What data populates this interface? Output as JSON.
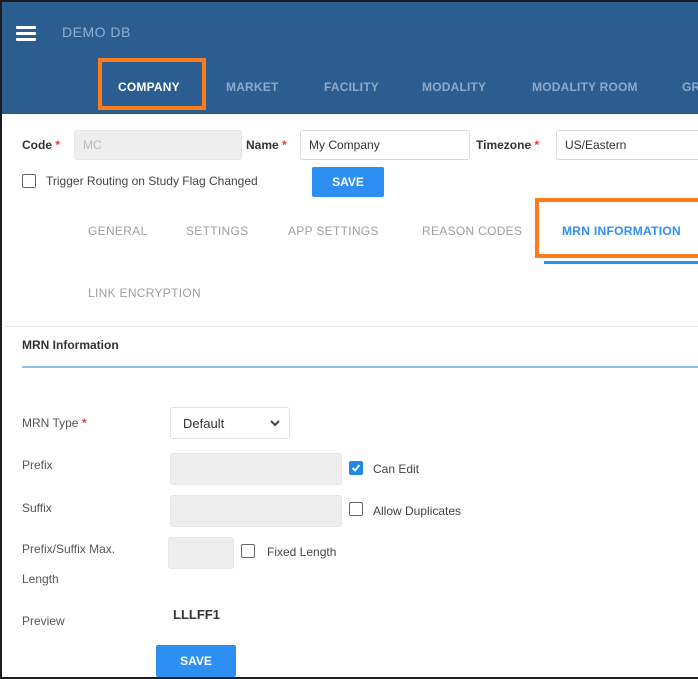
{
  "header": {
    "app_title": "DEMO DB",
    "nav_tabs": [
      {
        "label": "COMPANY",
        "active": true
      },
      {
        "label": "MARKET",
        "active": false
      },
      {
        "label": "FACILITY",
        "active": false
      },
      {
        "label": "MODALITY",
        "active": false
      },
      {
        "label": "MODALITY ROOM",
        "active": false
      },
      {
        "label": "GR",
        "active": false
      }
    ]
  },
  "company_form": {
    "code_label": "Code",
    "code_value": "MC",
    "name_label": "Name",
    "name_value": "My Company",
    "timezone_label": "Timezone",
    "timezone_value": "US/Eastern",
    "trigger_routing_label": "Trigger Routing on Study Flag Changed",
    "trigger_routing_checked": false,
    "save_label": "SAVE"
  },
  "sub_tabs": [
    {
      "label": "GENERAL",
      "active": false
    },
    {
      "label": "SETTINGS",
      "active": false
    },
    {
      "label": "APP SETTINGS",
      "active": false
    },
    {
      "label": "REASON CODES",
      "active": false
    },
    {
      "label": "MRN INFORMATION",
      "active": true
    },
    {
      "label": "LINK ENCRYPTION",
      "active": false
    }
  ],
  "mrn": {
    "section_title": "MRN Information",
    "type_label": "MRN Type",
    "type_value": "Default",
    "prefix_label": "Prefix",
    "prefix_value": "",
    "can_edit_label": "Can Edit",
    "can_edit_checked": true,
    "suffix_label": "Suffix",
    "suffix_value": "",
    "allow_duplicates_label": "Allow Duplicates",
    "allow_duplicates_checked": false,
    "max_length_label_line1": "Prefix/Suffix Max.",
    "max_length_label_line2": "Length",
    "max_length_value": "",
    "fixed_length_label": "Fixed Length",
    "fixed_length_checked": false,
    "preview_label": "Preview",
    "preview_value": "LLLFF1",
    "save_label": "SAVE"
  },
  "colors": {
    "header_bg": "#2b5d91",
    "accent": "#2e8ff2",
    "highlight": "#ff7a1a",
    "required": "#e53935"
  }
}
